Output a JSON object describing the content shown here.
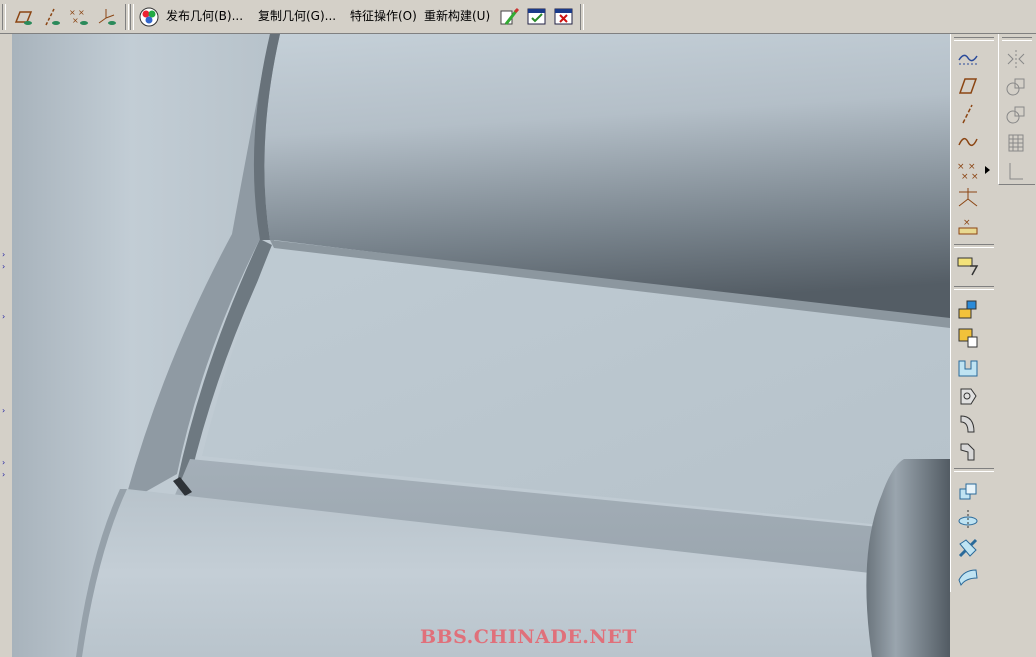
{
  "toolbar": {
    "menus": [
      {
        "label": "发布几何(B)..."
      },
      {
        "label": "复制几何(G)..."
      },
      {
        "label": "特征操作(O)"
      },
      {
        "label": "重新构建(U)"
      }
    ],
    "icons": [
      "datum-plane-display-icon",
      "datum-axis-display-icon",
      "datum-point-display-icon",
      "coordinate-system-display-icon",
      "appearance-color-icon",
      "regenerate-edit-icon",
      "window-activate-icon",
      "window-close-icon"
    ]
  },
  "right_toolbar": {
    "icons": [
      "sketch-datum-curve-icon",
      "datum-plane-icon",
      "datum-axis-icon",
      "datum-curve-icon",
      "datum-point-icon",
      "datum-coordinate-system-icon",
      "analysis-datum-icon",
      "sketch-note-icon",
      "extrude-icon",
      "revolve-icon",
      "sweep-icon",
      "blend-icon",
      "round-icon",
      "chamfer-icon",
      "draft-icon",
      "hole-icon",
      "shell-icon",
      "surface-icon"
    ]
  },
  "right_toolbar_2": {
    "icons": [
      "mirror-icon",
      "copy-icon",
      "pattern-icon",
      "table-icon",
      "trim-icon"
    ]
  },
  "watermark": "BBS.CHINADE.NET",
  "colors": {
    "ui_gray": "#d4d0c8",
    "model_light": "#c4ced6",
    "model_dark": "#4f5860",
    "watermark": "#e0707a"
  }
}
